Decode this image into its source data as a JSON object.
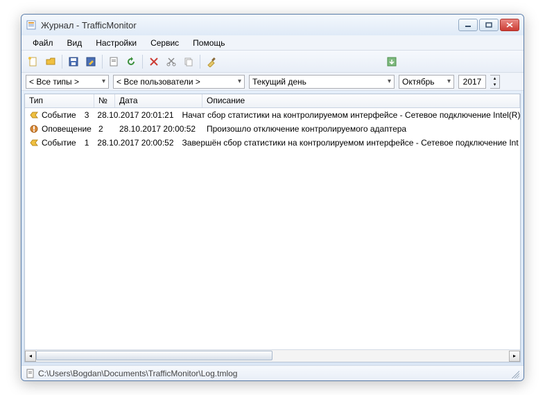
{
  "window": {
    "title": "Журнал - TrafficMonitor"
  },
  "menu": {
    "file": "Файл",
    "view": "Вид",
    "settings": "Настройки",
    "service": "Сервис",
    "help": "Помощь"
  },
  "filters": {
    "types": "< Все типы >",
    "users": "< Все пользователи >",
    "day": "Текущий день",
    "month": "Октябрь",
    "year": "2017"
  },
  "columns": {
    "type": "Тип",
    "num": "№",
    "date": "Дата",
    "desc": "Описание"
  },
  "rows": [
    {
      "icon": "event",
      "type": "Событие",
      "num": "3",
      "date": "28.10.2017 20:01:21",
      "desc": "Начат сбор статистики на контролируемом интерфейсе - Сетевое подключение Intel(R)"
    },
    {
      "icon": "alert",
      "type": "Оповещение",
      "num": "2",
      "date": "28.10.2017 20:00:52",
      "desc": "Произошло отключение контролируемого адаптера"
    },
    {
      "icon": "event",
      "type": "Событие",
      "num": "1",
      "date": "28.10.2017 20:00:52",
      "desc": "Завершён сбор статистики на контролируемом интерфейсе - Сетевое подключение Int"
    }
  ],
  "status": {
    "path": "C:\\Users\\Bogdan\\Documents\\TrafficMonitor\\Log.tmlog"
  }
}
